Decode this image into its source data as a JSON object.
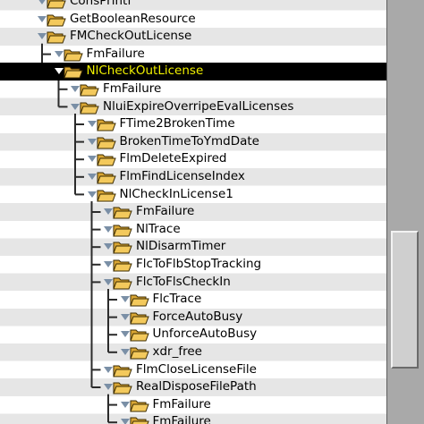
{
  "tree": {
    "nodes": [
      {
        "label": "ConsPrintf",
        "depth": 0,
        "expanded": false,
        "selected": false,
        "dim": false
      },
      {
        "label": "GetBooleanResource",
        "depth": 0,
        "expanded": true,
        "selected": false,
        "dim": false
      },
      {
        "label": "FMCheckOutLicense",
        "depth": 0,
        "expanded": true,
        "selected": false,
        "dim": false
      },
      {
        "label": "FmFailure",
        "depth": 1,
        "expanded": false,
        "selected": false,
        "dim": false
      },
      {
        "label": "NlCheckOutLicense",
        "depth": 1,
        "expanded": true,
        "selected": true,
        "dim": false
      },
      {
        "label": "FmFailure",
        "depth": 2,
        "expanded": false,
        "selected": false,
        "dim": false
      },
      {
        "label": "NluiExpireOverripeEvalLicenses",
        "depth": 2,
        "expanded": true,
        "selected": false,
        "dim": false
      },
      {
        "label": "FTime2BrokenTime",
        "depth": 3,
        "expanded": true,
        "selected": false,
        "dim": false
      },
      {
        "label": "BrokenTimeToYmdDate",
        "depth": 3,
        "expanded": true,
        "selected": false,
        "dim": false
      },
      {
        "label": "FlmDeleteExpired",
        "depth": 3,
        "expanded": true,
        "selected": false,
        "dim": false
      },
      {
        "label": "FlmFindLicenseIndex",
        "depth": 3,
        "expanded": true,
        "selected": false,
        "dim": false
      },
      {
        "label": "NlCheckInLicense1",
        "depth": 3,
        "expanded": true,
        "selected": false,
        "dim": false
      },
      {
        "label": "FmFailure",
        "depth": 4,
        "expanded": true,
        "selected": false,
        "dim": false
      },
      {
        "label": "NlTrace",
        "depth": 4,
        "expanded": true,
        "selected": false,
        "dim": false
      },
      {
        "label": "NlDisarmTimer",
        "depth": 4,
        "expanded": true,
        "selected": false,
        "dim": false
      },
      {
        "label": "FlcToFlbStopTracking",
        "depth": 4,
        "expanded": true,
        "selected": false,
        "dim": false
      },
      {
        "label": "FlcToFlsCheckIn",
        "depth": 4,
        "expanded": true,
        "selected": false,
        "dim": false
      },
      {
        "label": "FlcTrace",
        "depth": 5,
        "expanded": false,
        "selected": false,
        "dim": false
      },
      {
        "label": "ForceAutoBusy",
        "depth": 5,
        "expanded": false,
        "selected": false,
        "dim": false
      },
      {
        "label": "UnforceAutoBusy",
        "depth": 5,
        "expanded": false,
        "selected": false,
        "dim": false
      },
      {
        "label": "xdr_free",
        "depth": 5,
        "expanded": false,
        "selected": false,
        "dim": false
      },
      {
        "label": "FlmCloseLicenseFile",
        "depth": 4,
        "expanded": true,
        "selected": false,
        "dim": false
      },
      {
        "label": "RealDisposeFilePath",
        "depth": 4,
        "expanded": true,
        "selected": false,
        "dim": false
      },
      {
        "label": "FmFailure",
        "depth": 5,
        "expanded": false,
        "selected": false,
        "dim": false
      },
      {
        "label": "FmFailure",
        "depth": 5,
        "expanded": false,
        "selected": false,
        "dim": false
      }
    ]
  },
  "colors": {
    "selected_bg": "#000000",
    "selected_text": "#f0f000",
    "row_alt": "#e6e6e6",
    "guide_line": "#2b2b2b",
    "folder_fill": "#f3c95c"
  },
  "icons": {
    "node": "open-folder-icon",
    "toggle": "expand-triangle-icon"
  }
}
